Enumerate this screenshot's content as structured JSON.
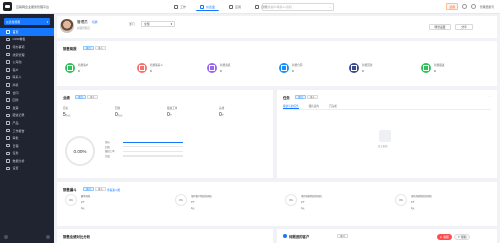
{
  "app": {
    "title": "互联网企业服务管理平台"
  },
  "topbar": {
    "tabs": [
      {
        "label": "工作",
        "active": false
      },
      {
        "label": "仪表盘",
        "active": true
      },
      {
        "label": "应用",
        "active": false
      },
      {
        "label": "通讯",
        "active": false
      }
    ],
    "search_placeholder": "搜索客户/联系人/商机",
    "badge": "试用",
    "user": "管理员账号"
  },
  "sidebar": {
    "selector": "仪表盘视图",
    "items": [
      {
        "label": "首页",
        "active": true
      },
      {
        "label": "CRM看板",
        "active": false
      },
      {
        "label": "待办事项",
        "active": false
      },
      {
        "label": "线索管理",
        "active": false
      },
      {
        "label": "公海池",
        "active": false
      },
      {
        "label": "客户",
        "active": false
      },
      {
        "label": "联系人",
        "active": false
      },
      {
        "label": "商机",
        "active": false
      },
      {
        "label": "合同",
        "active": false
      },
      {
        "label": "回款",
        "active": false
      },
      {
        "label": "发票",
        "active": false
      },
      {
        "label": "跟进记录",
        "active": false
      },
      {
        "label": "产品",
        "active": false
      },
      {
        "label": "工作报告",
        "active": false
      },
      {
        "label": "审批",
        "active": false
      },
      {
        "label": "日程",
        "active": false
      },
      {
        "label": "任务",
        "active": false
      },
      {
        "label": "数据分析",
        "active": false
      },
      {
        "label": "设置",
        "active": false
      }
    ]
  },
  "profile": {
    "name": "管理员",
    "link": "切换",
    "subtitle": "超级管理员",
    "department_label": "部门",
    "department_value": "全部",
    "btn_dashboard": "场景设置",
    "btn_share": "分享"
  },
  "kpis": {
    "title": "销售简报",
    "pill1": "本月",
    "pill2": "本人",
    "items": [
      {
        "name": "新增客户",
        "value": "0",
        "color": "#2fc25b"
      },
      {
        "name": "新增联系人",
        "value": "0",
        "color": "#f4716e"
      },
      {
        "name": "新增商机",
        "value": "0",
        "color": "#9a68f0"
      },
      {
        "name": "新增合同",
        "value": "0",
        "color": "#1890ff"
      },
      {
        "name": "新增回款",
        "value": "0",
        "color": "#3a4a8c"
      },
      {
        "name": "新增跟进",
        "value": "0",
        "color": "#2fc25b"
      }
    ]
  },
  "performance": {
    "title": "业绩",
    "pill1": "本月",
    "pill2": "本人",
    "stats": [
      {
        "name": "目标",
        "value": "5",
        "unit": "万元"
      },
      {
        "name": "回款",
        "value": "0",
        "unit": "万元"
      },
      {
        "name": "跟进工单",
        "value": "0",
        "unit": "个"
      },
      {
        "name": "完成",
        "value": "0",
        "unit": "个"
      }
    ],
    "completion": "0.00%",
    "legend": [
      {
        "label": "目标",
        "filled": true
      },
      {
        "label": "回款",
        "filled": false
      },
      {
        "label": "跟进工单",
        "filled": false
      },
      {
        "label": "完成",
        "filled": false
      }
    ]
  },
  "todo": {
    "title": "任务",
    "pill1": "本月",
    "pill2": "本人",
    "more": "···",
    "tabs": [
      "我参与的任务",
      "我负责的",
      "已完成"
    ],
    "empty": "暂无数据"
  },
  "funnel": {
    "title": "销售漏斗",
    "pill1": "本月",
    "pill2": "本人",
    "link": "查看漏斗图",
    "items": [
      {
        "pct": "0%",
        "l1": "赢单商机",
        "l2": "0个",
        "l3": "0元"
      },
      {
        "pct": "0%",
        "l1": "带有客户阶段的商机",
        "l2": "0个",
        "l3": "0元"
      },
      {
        "pct": "0%",
        "l1": "带有商机阶段的商机",
        "l2": "0个",
        "l3": "0元"
      },
      {
        "pct": "0%",
        "l1": "带有商机阶段的商机",
        "l2": "0个",
        "l3": "0元"
      }
    ]
  },
  "bottom": {
    "left_title": "销售业绩对比分析",
    "right_title": "待跟进的客户",
    "right_pill": "本月"
  },
  "float": {
    "btn1": "客服",
    "btn2": "帮助"
  }
}
